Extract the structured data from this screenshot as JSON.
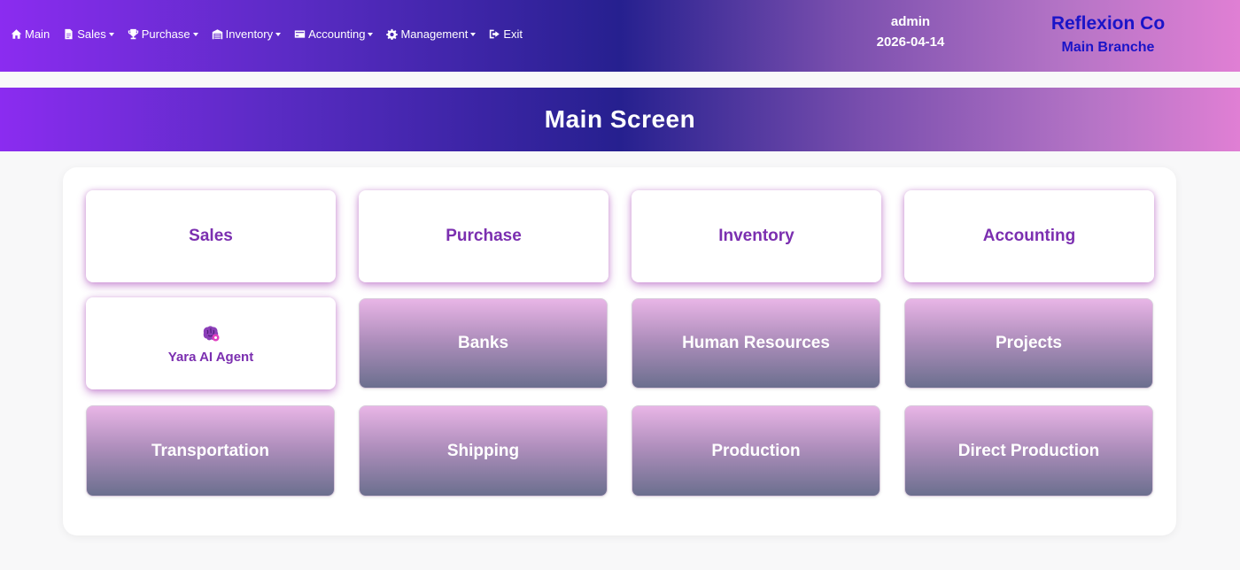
{
  "nav": {
    "items": [
      {
        "label": "Main",
        "icon": "home-icon",
        "dropdown": false
      },
      {
        "label": "Sales",
        "icon": "document-icon",
        "dropdown": true
      },
      {
        "label": "Purchase",
        "icon": "trophy-icon",
        "dropdown": true
      },
      {
        "label": "Inventory",
        "icon": "warehouse-icon",
        "dropdown": true
      },
      {
        "label": "Accounting",
        "icon": "credit-card-icon",
        "dropdown": true
      },
      {
        "label": "Management",
        "icon": "gear-icon",
        "dropdown": true
      },
      {
        "label": "Exit",
        "icon": "sign-out-icon",
        "dropdown": false
      }
    ]
  },
  "user": {
    "name": "admin",
    "date": "2026-04-14"
  },
  "company": {
    "name": "Reflexion Co",
    "branch": "Main Branche"
  },
  "banner": {
    "title": "Main Screen"
  },
  "tiles": [
    {
      "label": "Sales",
      "style": "white"
    },
    {
      "label": "Purchase",
      "style": "white"
    },
    {
      "label": "Inventory",
      "style": "white"
    },
    {
      "label": "Accounting",
      "style": "white"
    },
    {
      "label": "Yara AI Agent",
      "style": "white",
      "icon": "brain-icon"
    },
    {
      "label": "Banks",
      "style": "gradient"
    },
    {
      "label": "Human Resources",
      "style": "gradient"
    },
    {
      "label": "Projects",
      "style": "gradient"
    },
    {
      "label": "Transportation",
      "style": "gradient"
    },
    {
      "label": "Shipping",
      "style": "gradient"
    },
    {
      "label": "Production",
      "style": "gradient"
    },
    {
      "label": "Direct Production",
      "style": "gradient"
    }
  ],
  "colors": {
    "accent_purple": "#8b2cf0",
    "navy": "#26208f",
    "pink": "#e07fd4",
    "tile_text": "#7b2fb0",
    "company_text": "#1a14c8"
  }
}
